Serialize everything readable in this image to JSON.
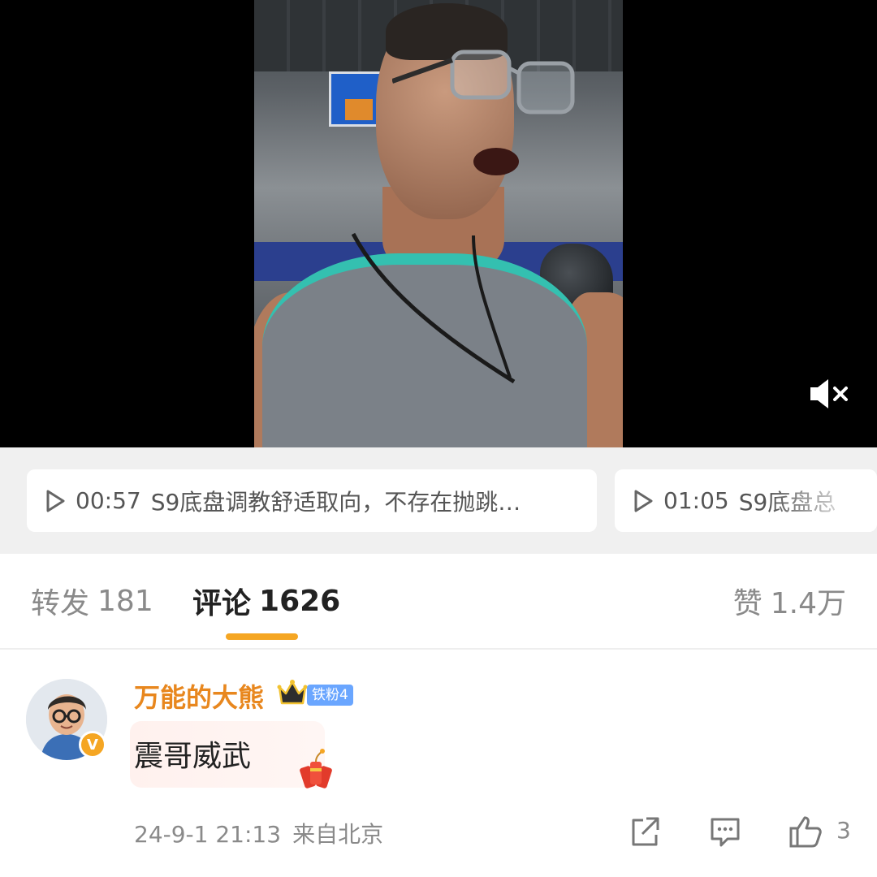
{
  "video": {
    "mute_icon": "speaker-muted-icon"
  },
  "chapters": [
    {
      "time": "00:57",
      "text": "S9底盘调教舒适取向，不存在抛跳…"
    },
    {
      "time": "01:05",
      "text": "S9底盘总"
    }
  ],
  "tabs": {
    "repost": {
      "label": "转发",
      "count": "181"
    },
    "comment": {
      "label": "评论",
      "count": "1626"
    },
    "like": {
      "label": "赞",
      "count": "1.4万"
    }
  },
  "comment": {
    "username": "万能的大熊",
    "verified_badge": "V",
    "fan_badge": "铁粉4",
    "text": "震哥威武",
    "date": "24-9-1 21:13",
    "location": "来自北京",
    "like_count": "3"
  },
  "colors": {
    "accent": "#f5a623",
    "username": "#e8871e",
    "fan_badge": "#6aa6ff"
  }
}
